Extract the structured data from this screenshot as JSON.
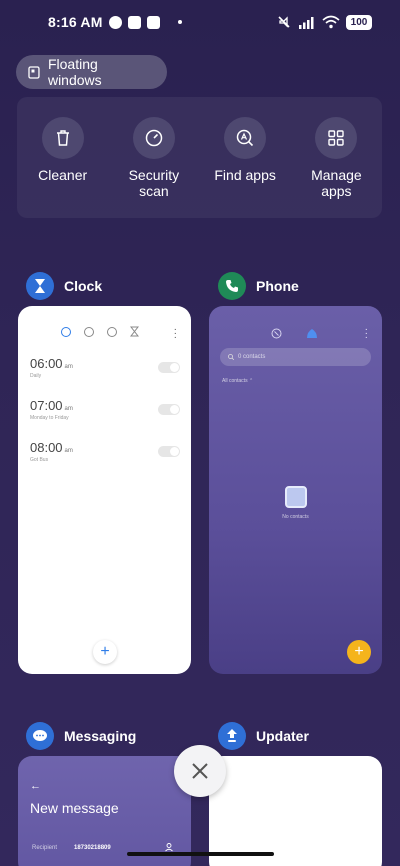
{
  "status_bar": {
    "time": "8:16 AM",
    "battery": "100",
    "icons": [
      "data-icon",
      "shield-icon",
      "app-icon",
      "dot-icon",
      "mute-icon",
      "signal-icon",
      "wifi-icon"
    ]
  },
  "floating_windows": {
    "label": "Floating windows",
    "icon": "floating-window-icon"
  },
  "quick_actions": [
    {
      "label": "Cleaner",
      "icon": "trash-icon"
    },
    {
      "label": "Security scan",
      "icon": "gauge-icon"
    },
    {
      "label": "Find apps",
      "icon": "find-apps-icon"
    },
    {
      "label": "Manage apps",
      "icon": "grid-icon"
    }
  ],
  "apps": {
    "clock": {
      "name": "Clock",
      "icon": "hourglass-icon",
      "color": "#2f6fd6",
      "alarms": [
        {
          "time": "06:00",
          "period": "am",
          "label": "Daily"
        },
        {
          "time": "07:00",
          "period": "am",
          "label": "Monday to Friday"
        },
        {
          "time": "08:00",
          "period": "am",
          "label": "Got Bus"
        }
      ]
    },
    "phone": {
      "name": "Phone",
      "icon": "phone-icon",
      "color": "#1f8a57",
      "search_placeholder": "0 contacts",
      "filter_label": "All contacts",
      "empty_text": "No contacts"
    },
    "messaging": {
      "name": "Messaging",
      "icon": "chat-icon",
      "color": "#2f6fd6",
      "title": "New message",
      "recipient_label": "Recipient",
      "recipient_number": "18730218809"
    },
    "updater": {
      "name": "Updater",
      "icon": "updater-icon",
      "color": "#2f6fd6"
    }
  },
  "close_button": {
    "icon": "close-icon"
  }
}
